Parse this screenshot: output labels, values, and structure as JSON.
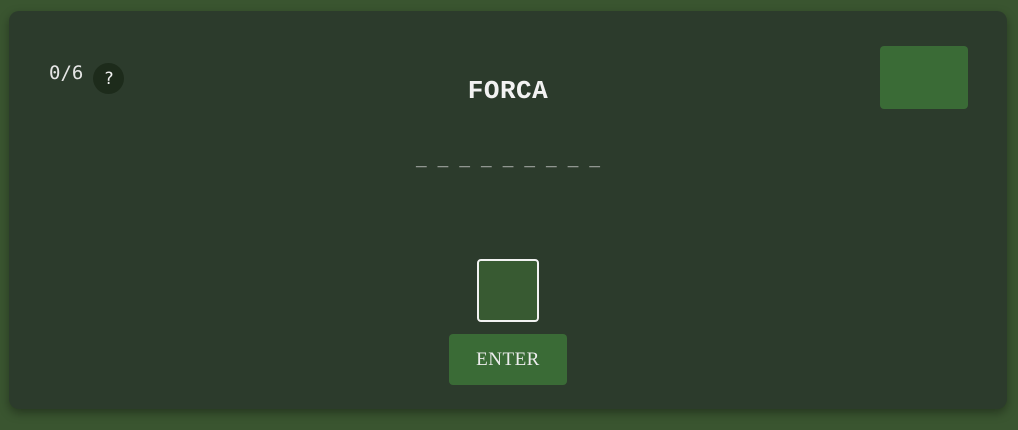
{
  "game": {
    "title": "FORCA",
    "score": "0/6",
    "help_label": "?",
    "word_display": "_ _ _ _ _ _ _ _ _",
    "letter_input": {
      "value": "",
      "placeholder": ""
    },
    "enter_label": "ENTER"
  },
  "colors": {
    "page_background": "#3a5530",
    "card_background": "#2c3b2c",
    "button_green": "#3a6b36",
    "help_button": "#1d2b1b",
    "input_background": "#385a32"
  }
}
